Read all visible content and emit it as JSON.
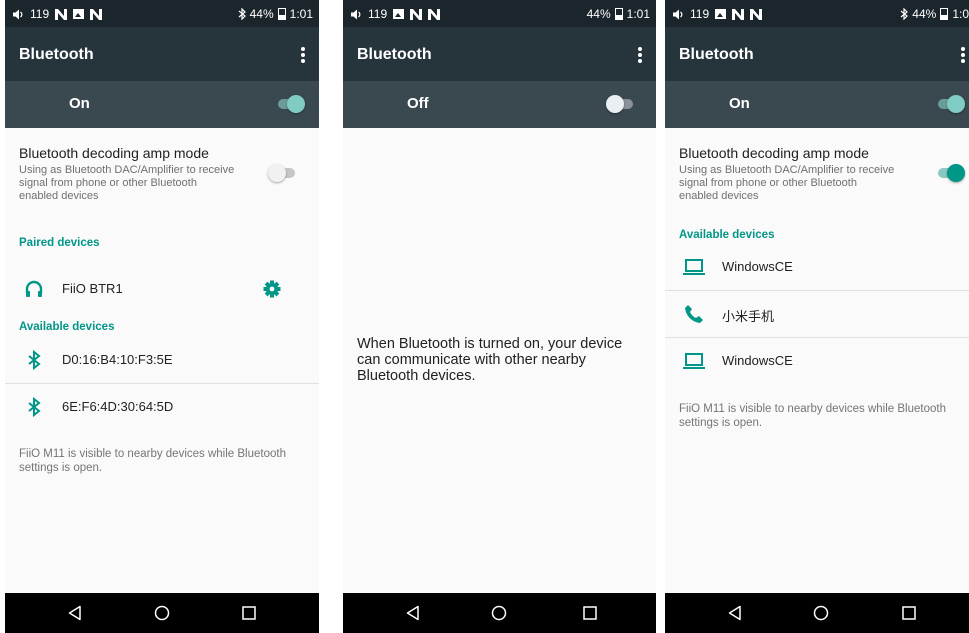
{
  "colors": {
    "accent": "#009688",
    "appbar": "#26343c",
    "switchbar": "#3a4950",
    "statusbar": "#1b252c"
  },
  "screens": [
    {
      "status": {
        "volume": "119",
        "battery": "44%",
        "time": "1:01",
        "bluetooth_icon": "bluetooth-icon"
      },
      "title": "Bluetooth",
      "switch_label": "On",
      "switch_on": true,
      "amp_title": "Bluetooth decoding amp mode",
      "amp_desc": "Using as Bluetooth DAC/Amplifier to receive signal from phone or other Bluetooth enabled devices",
      "amp_on": false,
      "paired_header": "Paired devices",
      "paired": [
        {
          "name": "FiiO BTR1",
          "icon": "headphones-icon"
        }
      ],
      "available_header": "Available devices",
      "available": [
        {
          "name": "D0:16:B4:10:F3:5E",
          "icon": "bluetooth-icon"
        },
        {
          "name": "6E:F6:4D:30:64:5D",
          "icon": "bluetooth-icon"
        }
      ],
      "note": "FiiO M11 is visible to nearby devices while Bluetooth settings is open."
    },
    {
      "status": {
        "volume": "119",
        "battery": "44%",
        "time": "1:01"
      },
      "title": "Bluetooth",
      "switch_label": "Off",
      "switch_on": false,
      "message": "When Bluetooth is turned on, your device can communicate with other nearby Bluetooth devices."
    },
    {
      "status": {
        "volume": "119",
        "battery": "44%",
        "time": "1:0",
        "bluetooth_icon": "bluetooth-icon"
      },
      "title": "Bluetooth",
      "switch_label": "On",
      "switch_on": true,
      "amp_title": "Bluetooth decoding amp mode",
      "amp_desc": "Using as Bluetooth DAC/Amplifier to receive signal from phone or other Bluetooth enabled devices",
      "amp_on": true,
      "available_header": "Available devices",
      "available": [
        {
          "name": "WindowsCE",
          "icon": "laptop-icon"
        },
        {
          "name": "小米手机",
          "icon": "phone-icon"
        },
        {
          "name": "WindowsCE",
          "icon": "laptop-icon"
        }
      ],
      "note": "FiiO M11 is visible to nearby devices while Bluetooth settings is open."
    }
  ],
  "navbar": {
    "back": "back-icon",
    "home": "home-icon",
    "recents": "recents-icon"
  }
}
